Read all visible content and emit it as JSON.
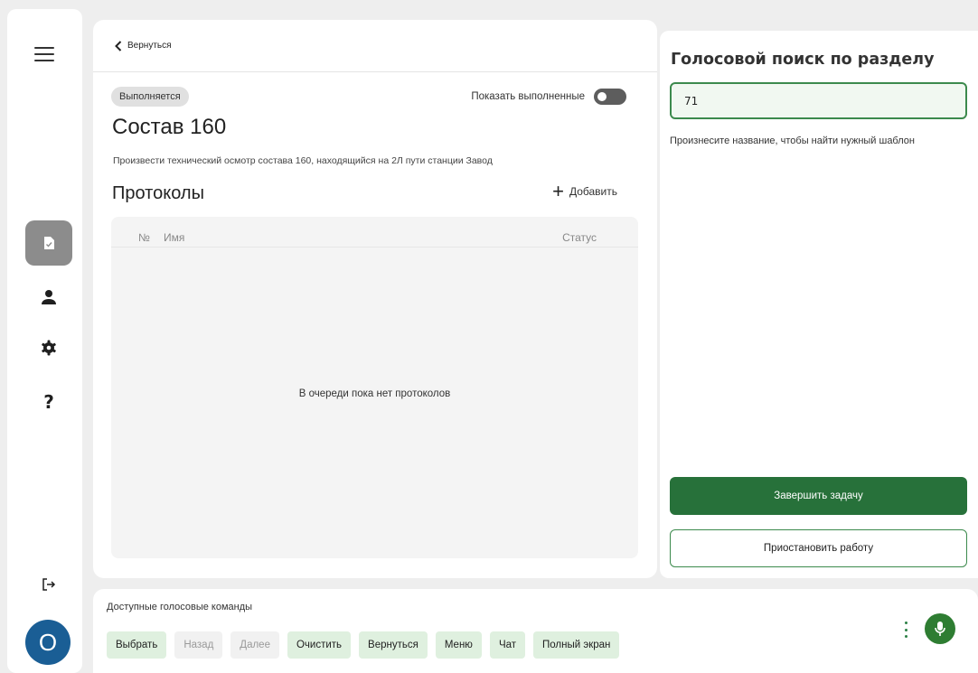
{
  "sidebar": {
    "items": [
      {
        "name": "document-check-icon",
        "active": true
      },
      {
        "name": "person-icon",
        "active": false
      },
      {
        "name": "gear-icon",
        "active": false
      },
      {
        "name": "help-icon",
        "label": "?",
        "active": false
      }
    ],
    "avatar_initial": "O"
  },
  "main": {
    "back_label": "Вернуться",
    "status_chip": "Выполняется",
    "show_done_label": "Показать выполненные",
    "show_done_enabled": false,
    "title": "Состав 160",
    "description": "Произвести технический осмотр состава 160, находящийся на 2Л пути станции Завод",
    "protocols_title": "Протоколы",
    "add_label": "Добавить",
    "table": {
      "col_num": "№",
      "col_name": "Имя",
      "col_status": "Статус",
      "empty_message": "В очереди пока нет протоколов"
    }
  },
  "voice_panel": {
    "title": "Голосовой поиск по разделу",
    "input_value": "71",
    "hint": "Произнесите название, чтобы найти нужный шаблон",
    "complete_label": "Завершить задачу",
    "pause_label": "Приостановить работу"
  },
  "commands": {
    "title": "Доступные голосовые команды",
    "items": [
      {
        "label": "Выбрать",
        "enabled": true
      },
      {
        "label": "Назад",
        "enabled": false
      },
      {
        "label": "Далее",
        "enabled": false
      },
      {
        "label": "Очистить",
        "enabled": true
      },
      {
        "label": "Вернуться",
        "enabled": true
      },
      {
        "label": "Меню",
        "enabled": true
      },
      {
        "label": "Чат",
        "enabled": true
      },
      {
        "label": "Полный экран",
        "enabled": true
      }
    ]
  },
  "colors": {
    "accent_green": "#27713a",
    "avatar_blue": "#1a5e95",
    "command_bg": "#dff0df"
  }
}
